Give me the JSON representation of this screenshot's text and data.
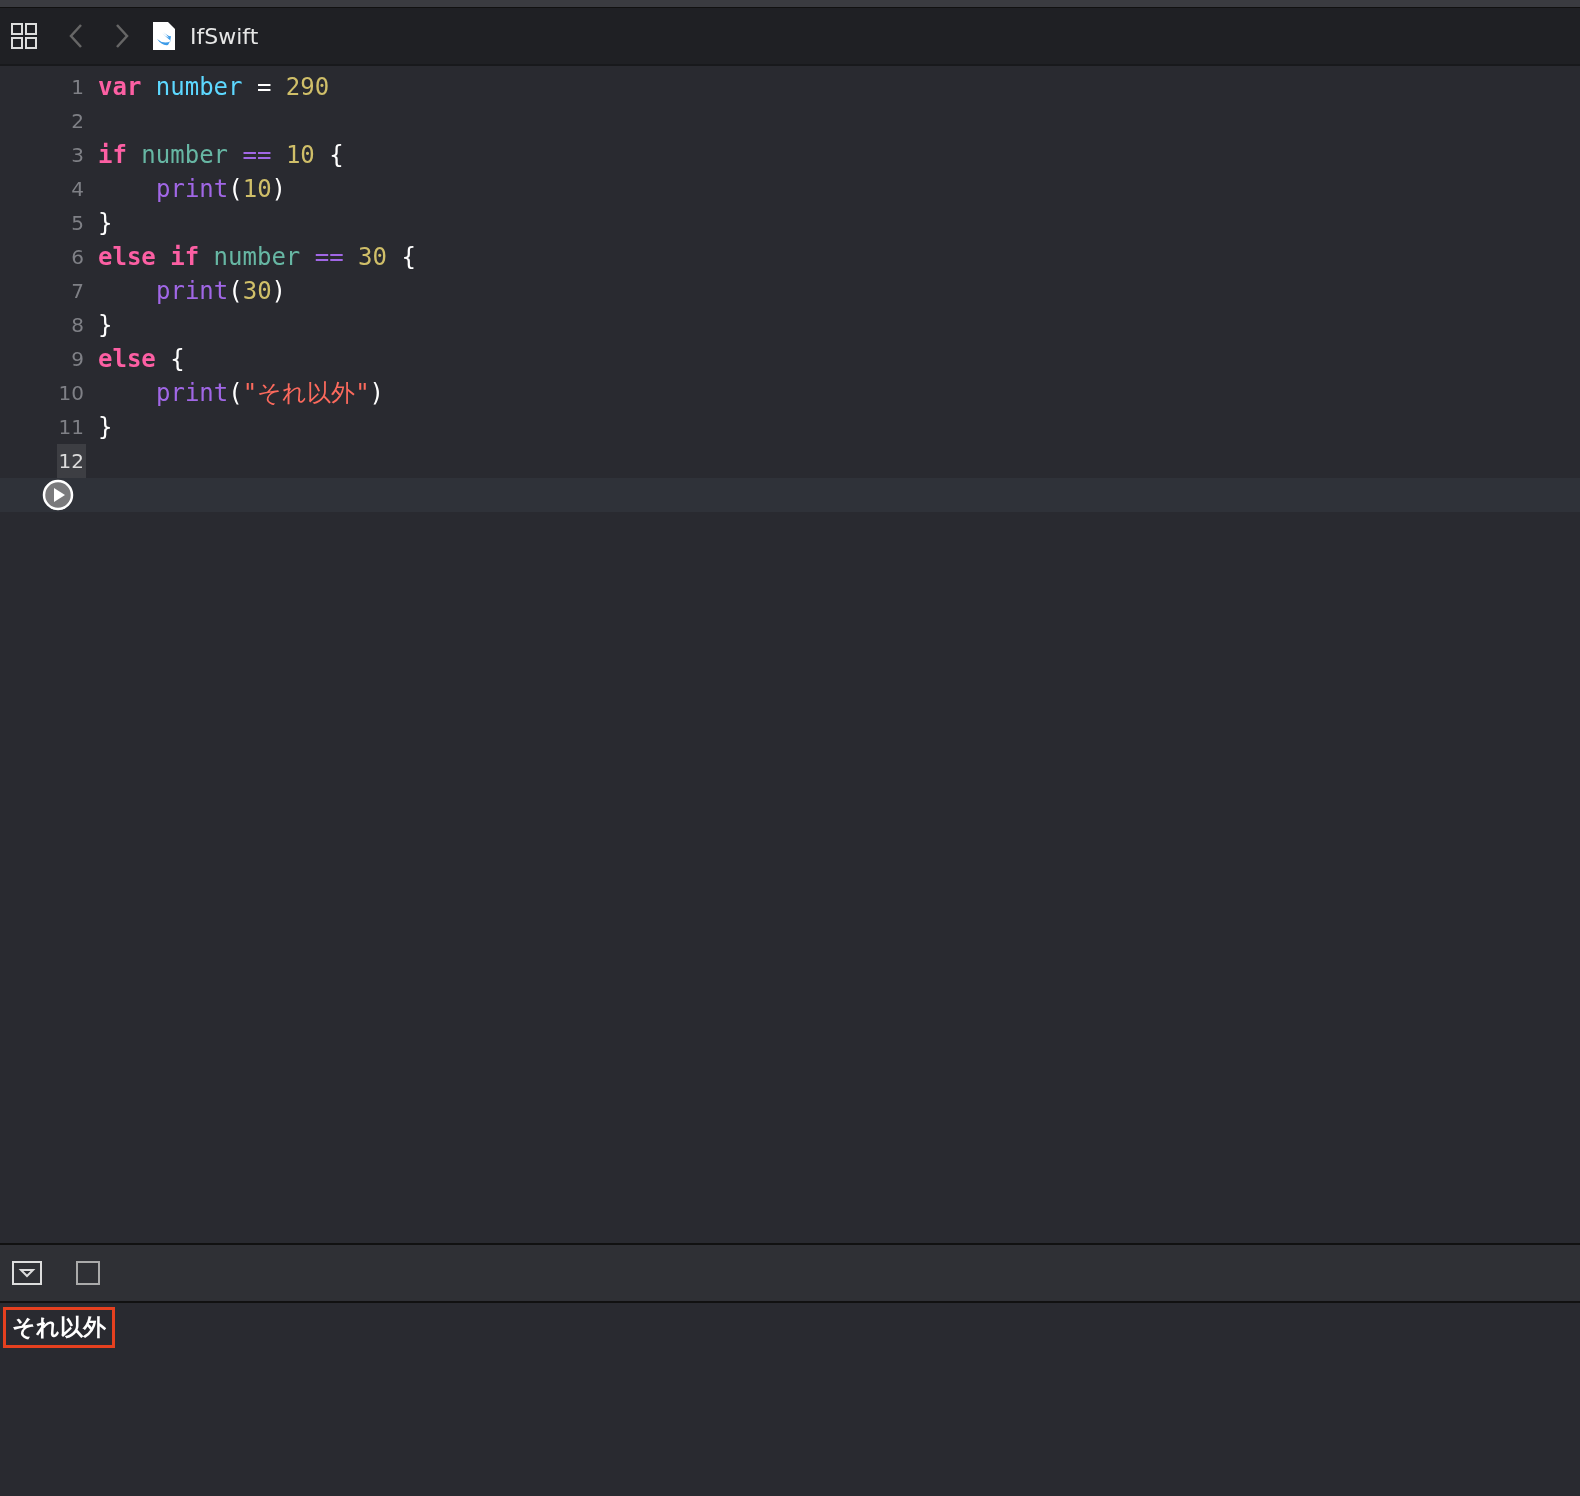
{
  "toolbar": {
    "file_name": "IfSwift"
  },
  "editor": {
    "lines": [
      {
        "number": "1",
        "current": false,
        "kind": "top",
        "tokens": [
          {
            "kind": "keyword",
            "text": "var "
          },
          {
            "kind": "declaration",
            "text": "number"
          },
          {
            "kind": "plain",
            "text": " = "
          },
          {
            "kind": "number",
            "text": "290"
          }
        ]
      },
      {
        "number": "2",
        "current": false,
        "kind": "blank"
      },
      {
        "number": "3",
        "current": false,
        "kind": "top",
        "tokens": [
          {
            "kind": "keyword",
            "text": "if "
          },
          {
            "kind": "identifier",
            "text": "number "
          },
          {
            "kind": "operator",
            "text": "== "
          },
          {
            "kind": "number",
            "text": "10"
          },
          {
            "kind": "plain",
            "text": " {"
          }
        ]
      },
      {
        "number": "4",
        "current": false,
        "kind": "nested",
        "tokens": [
          {
            "kind": "function",
            "text": "print"
          },
          {
            "kind": "plain",
            "text": "("
          },
          {
            "kind": "number",
            "text": "10"
          },
          {
            "kind": "plain",
            "text": ")"
          }
        ]
      },
      {
        "number": "5",
        "current": false,
        "kind": "top",
        "tokens": [
          {
            "kind": "plain",
            "text": "}"
          }
        ]
      },
      {
        "number": "6",
        "current": false,
        "kind": "top",
        "tokens": [
          {
            "kind": "keyword",
            "text": "else if "
          },
          {
            "kind": "identifier",
            "text": "number "
          },
          {
            "kind": "operator",
            "text": "== "
          },
          {
            "kind": "number",
            "text": "30"
          },
          {
            "kind": "plain",
            "text": " {"
          }
        ]
      },
      {
        "number": "7",
        "current": false,
        "kind": "nested",
        "tokens": [
          {
            "kind": "function",
            "text": "print"
          },
          {
            "kind": "plain",
            "text": "("
          },
          {
            "kind": "number",
            "text": "30"
          },
          {
            "kind": "plain",
            "text": ")"
          }
        ]
      },
      {
        "number": "8",
        "current": false,
        "kind": "top",
        "tokens": [
          {
            "kind": "plain",
            "text": "}"
          }
        ]
      },
      {
        "number": "9",
        "current": false,
        "kind": "top",
        "tokens": [
          {
            "kind": "keyword",
            "text": "else "
          },
          {
            "kind": "plain",
            "text": "{"
          }
        ]
      },
      {
        "number": "10",
        "current": false,
        "kind": "nested",
        "tokens": [
          {
            "kind": "function",
            "text": "print"
          },
          {
            "kind": "plain",
            "text": "("
          },
          {
            "kind": "string",
            "text": "\"それ以外\""
          },
          {
            "kind": "plain",
            "text": ")"
          }
        ]
      },
      {
        "number": "11",
        "current": false,
        "kind": "top",
        "tokens": [
          {
            "kind": "plain",
            "text": "}"
          }
        ]
      },
      {
        "number": "12",
        "current": true,
        "kind": "blank"
      }
    ]
  },
  "console": {
    "output": "それ以外",
    "highlighted": true
  }
}
